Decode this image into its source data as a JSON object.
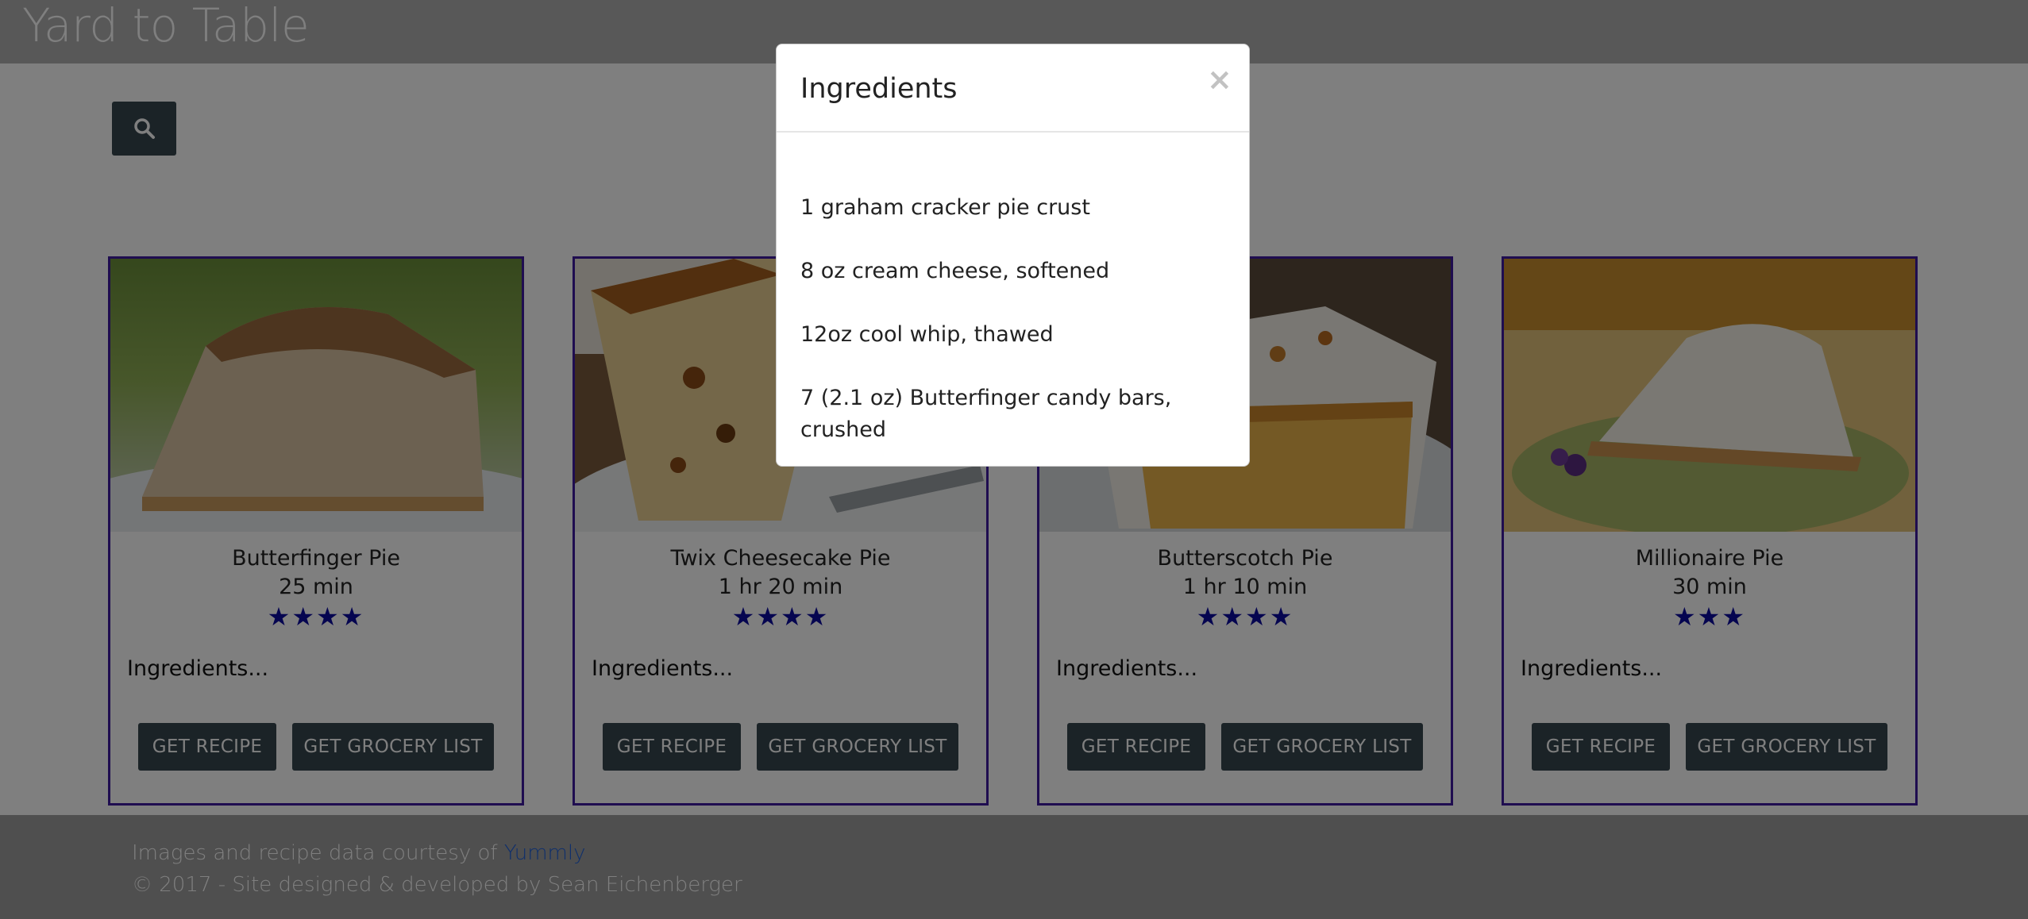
{
  "header": {
    "brand": "Yard to Table"
  },
  "search": {
    "icon": "search-icon"
  },
  "cards": [
    {
      "title": "Butterfinger Pie",
      "time": "25 min",
      "stars": "★★★★",
      "rating": 4,
      "ingredients_label": "Ingredients...",
      "recipe_button": "GET RECIPE",
      "grocery_button": "GET GROCERY LIST"
    },
    {
      "title": "Twix Cheesecake Pie",
      "time": "1 hr 20 min",
      "stars": "★★★★",
      "rating": 4,
      "ingredients_label": "Ingredients...",
      "recipe_button": "GET RECIPE",
      "grocery_button": "GET GROCERY LIST"
    },
    {
      "title": "Butterscotch Pie",
      "time": "1 hr 10 min",
      "stars": "★★★★",
      "rating": 4,
      "ingredients_label": "Ingredients...",
      "recipe_button": "GET RECIPE",
      "grocery_button": "GET GROCERY LIST"
    },
    {
      "title": "Millionaire Pie",
      "time": "30 min",
      "stars": "★★★",
      "rating": 3,
      "ingredients_label": "Ingredients...",
      "recipe_button": "GET RECIPE",
      "grocery_button": "GET GROCERY LIST"
    }
  ],
  "modal": {
    "title": "Ingredients",
    "close": "×",
    "items": [
      "1 graham cracker pie crust",
      "8 oz cream cheese, softened",
      "12oz cool whip, thawed",
      "7 (2.1 oz) Butterfinger candy bars, crushed"
    ]
  },
  "footer": {
    "credit_prefix": "Images and recipe data courtesy of ",
    "credit_link": "Yummly",
    "copyright": "© 2017 - Site designed & developed by Sean Eichenberger"
  },
  "colors": {
    "button": "#37474f",
    "card_border": "#3f1aa0",
    "stars": "#0a0aa0",
    "link": "#1e5fd6",
    "overlay": "rgba(0,0,0,0.5)"
  }
}
